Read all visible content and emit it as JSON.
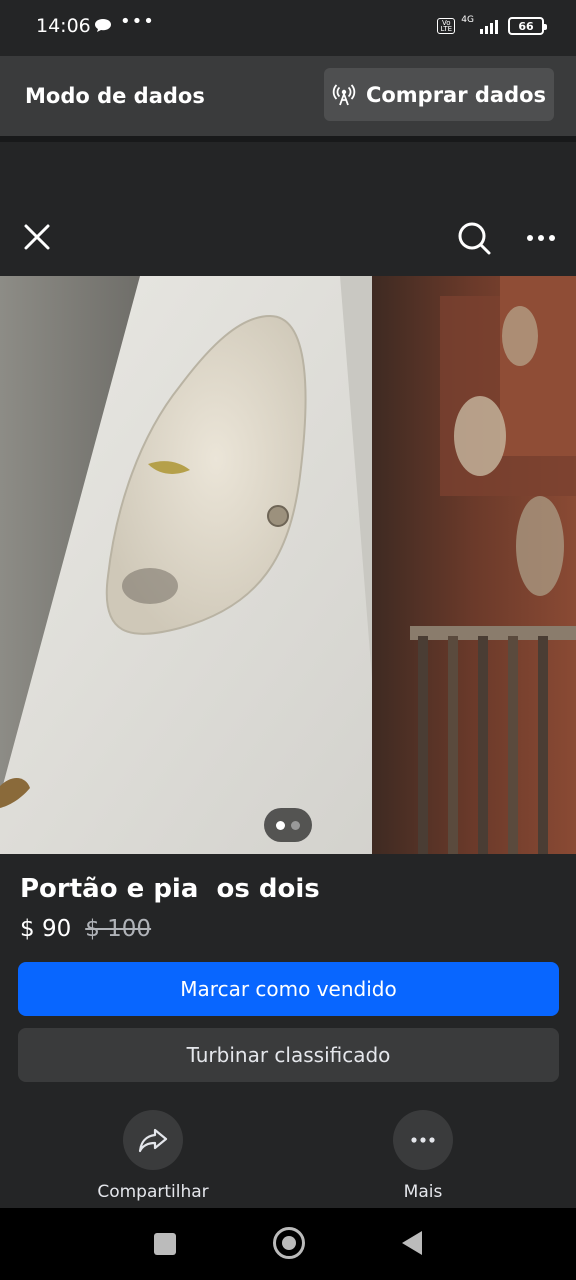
{
  "status_bar": {
    "time": "14:06",
    "icons": [
      "chat-bubble-icon",
      "more-dots-icon"
    ],
    "volte_label": "VoLTE",
    "network": "4G",
    "battery": "66"
  },
  "data_banner": {
    "mode_label": "Modo de dados",
    "buy_label": "Comprar dados"
  },
  "topbar": {
    "icons": [
      "close-icon",
      "search-icon",
      "more-icon"
    ]
  },
  "photo": {
    "current_page": 1,
    "total_pages": 2
  },
  "listing": {
    "title": "Portão e pia  os dois",
    "price": "$ 90",
    "old_price": "$ 100"
  },
  "buttons": {
    "mark_sold": "Marcar como vendido",
    "boost": "Turbinar classificado"
  },
  "actions": {
    "share": "Compartilhar",
    "more": "Mais"
  },
  "colors": {
    "accent": "#0866ff",
    "background": "#242526",
    "surface": "#3a3b3c"
  }
}
